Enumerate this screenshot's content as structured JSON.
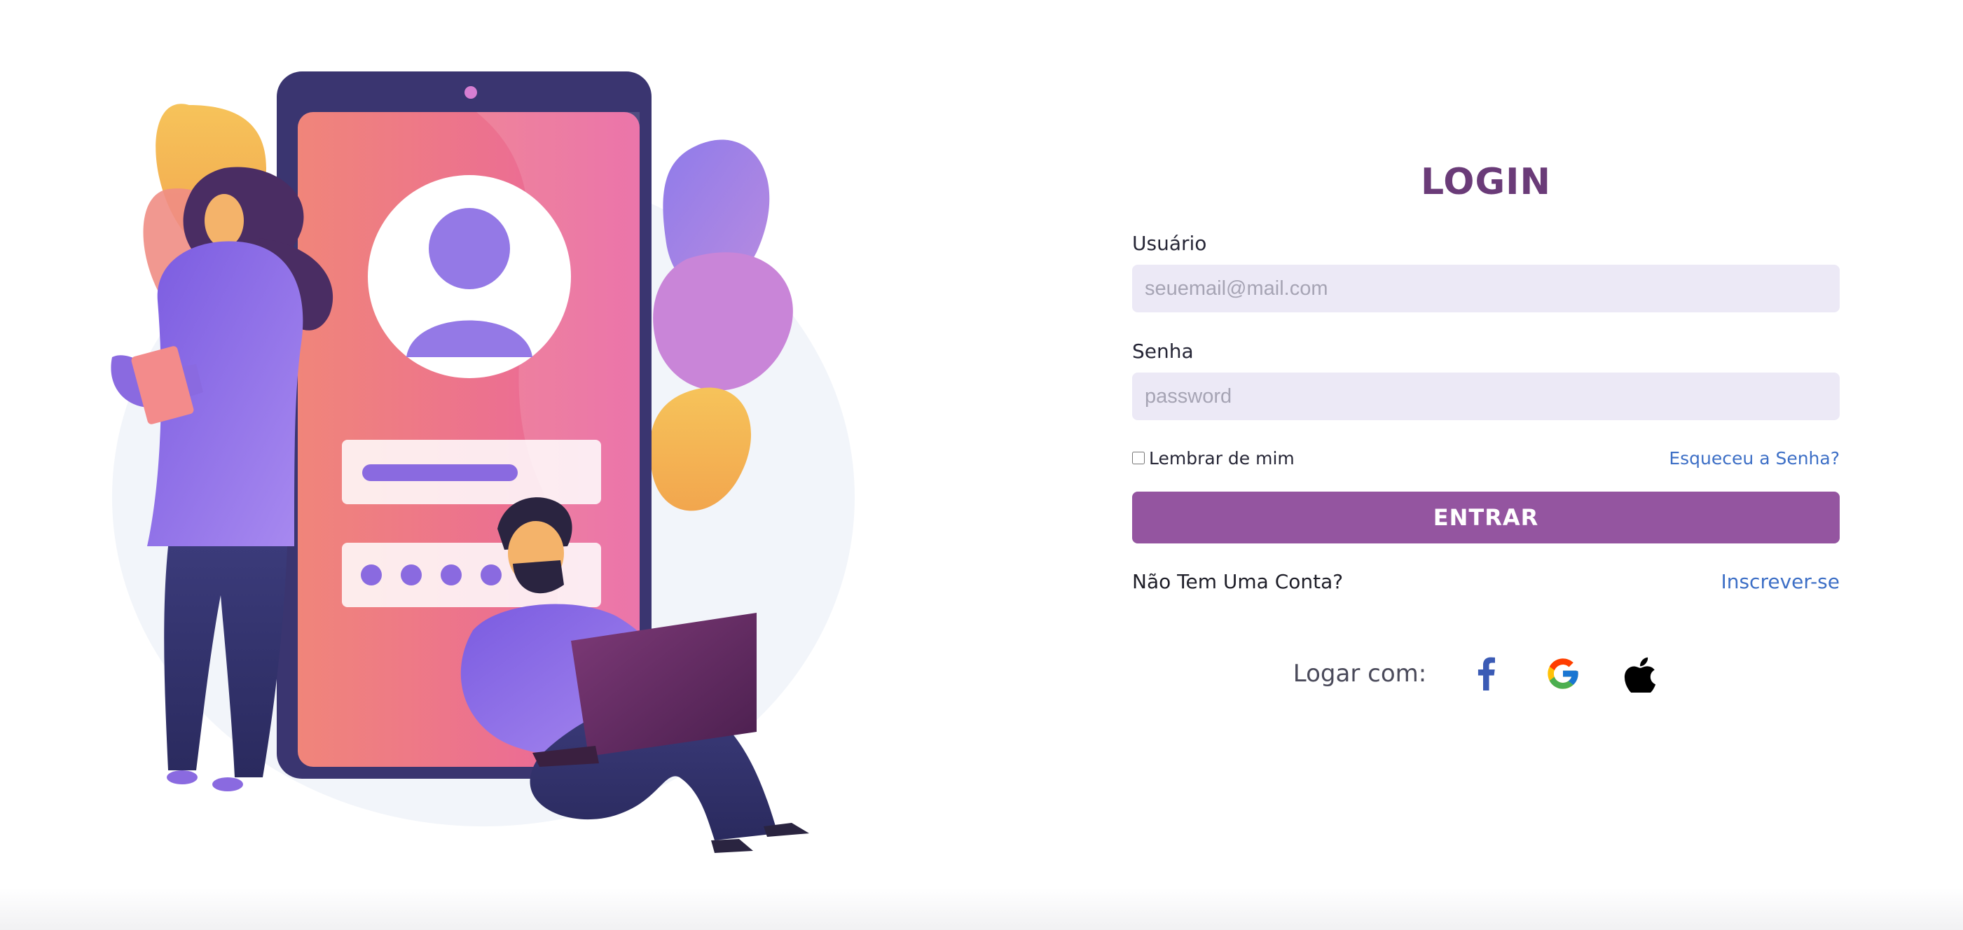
{
  "login": {
    "title": "LOGIN",
    "username_label": "Usuário",
    "username_placeholder": "seuemail@mail.com",
    "username_value": "",
    "password_label": "Senha",
    "password_placeholder": "password",
    "password_value": "",
    "remember_label": "Lembrar de mim",
    "remember_checked": false,
    "forgot_link": "Esqueceu a Senha?",
    "submit_label": "ENTRAR",
    "no_account_text": "Não Tem Uma Conta?",
    "signup_link": "Inscrever-se",
    "social_label": "Logar com:",
    "social_providers": [
      "facebook-icon",
      "google-icon",
      "apple-icon"
    ]
  },
  "colors": {
    "title": "#6a3b78",
    "button": "#9455a0",
    "input_bg": "#ece9f6",
    "link": "#3d6fc6"
  }
}
